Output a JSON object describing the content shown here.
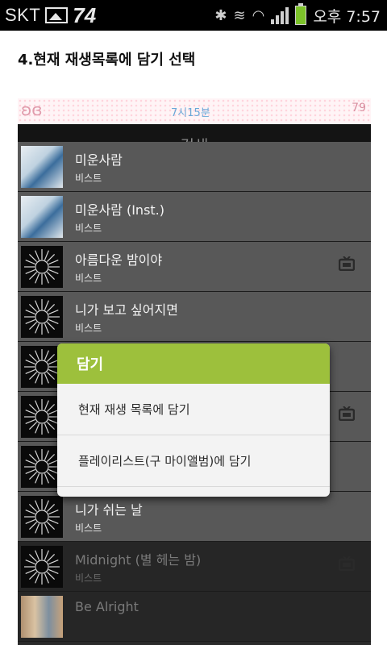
{
  "statusbar": {
    "carrier": "SKT",
    "temperature": "74",
    "clock": "오후 7:57",
    "icons": [
      "gallery-icon",
      "bluetooth-icon",
      "vibrate-icon",
      "wifi-icon",
      "signal-icon",
      "battery-icon"
    ]
  },
  "heading": "4.현재 재생목록에 담기 선택",
  "app": {
    "statusbar": {
      "clock": "7시15분",
      "right_text": "79"
    },
    "title": "검색",
    "songs": [
      {
        "title": "미운사람",
        "artist": "비스트",
        "thumb": "photo",
        "shade": "light",
        "tv": false
      },
      {
        "title": "미운사람 (Inst.)",
        "artist": "비스트",
        "thumb": "photo",
        "shade": "light",
        "tv": false
      },
      {
        "title": "아름다운 밤이야",
        "artist": "비스트",
        "thumb": "art",
        "shade": "light",
        "tv": true
      },
      {
        "title": "니가 보고 싶어지면",
        "artist": "비스트",
        "thumb": "art",
        "shade": "light",
        "tv": false
      },
      {
        "title": "",
        "artist": "",
        "thumb": "art",
        "shade": "light",
        "tv": false
      },
      {
        "title": "",
        "artist": "",
        "thumb": "art",
        "shade": "light",
        "tv": true
      },
      {
        "title": "",
        "artist": "",
        "thumb": "art",
        "shade": "light",
        "tv": false
      },
      {
        "title": "니가 쉬는 날",
        "artist": "비스트",
        "thumb": "art",
        "shade": "light",
        "tv": false
      },
      {
        "title": "Midnight (별 헤는 밤)",
        "artist": "비스트",
        "thumb": "art",
        "shade": "dark",
        "tv": true
      },
      {
        "title": "Be Alright",
        "artist": "",
        "thumb": "group",
        "shade": "dark",
        "tv": false
      }
    ],
    "dialog": {
      "title": "담기",
      "options": [
        "현재 재생 목록에 담기",
        "플레이리스트(구 마이앨범)에 담기"
      ]
    }
  },
  "colors": {
    "accent_green": "#9dc03c",
    "battery_green": "#7cc22a"
  }
}
